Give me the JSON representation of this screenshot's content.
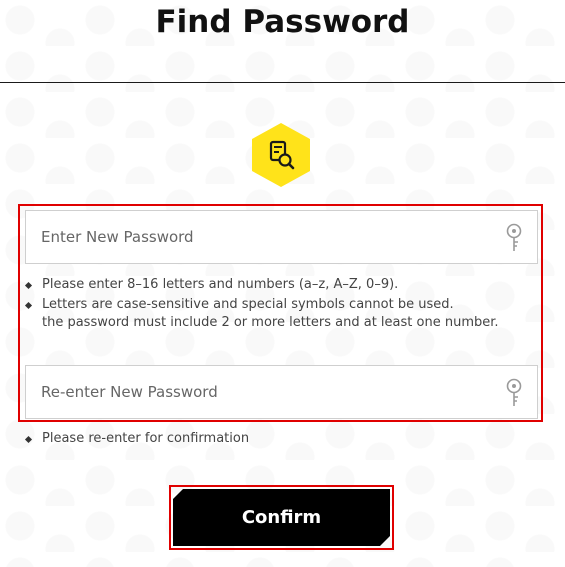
{
  "page": {
    "title": "Find Password"
  },
  "badge": {
    "icon": "search-document-icon",
    "color": "#FFE31A"
  },
  "form": {
    "new_password": {
      "value": "",
      "placeholder": "Enter New Password",
      "icon": "key-icon"
    },
    "requirements": [
      {
        "lines": [
          "Please enter 8–16 letters and numbers (a–z, A–Z, 0–9)."
        ]
      },
      {
        "lines": [
          "Letters are case-sensitive and special symbols cannot be used.",
          "the password must include 2 or more letters and at least one number."
        ]
      }
    ],
    "confirm_password": {
      "value": "",
      "placeholder": "Re-enter New Password",
      "icon": "key-icon"
    },
    "confirm_hint": "Please re-enter for confirmation"
  },
  "actions": {
    "confirm_label": "Confirm"
  },
  "colors": {
    "highlight": "#E00000",
    "button": "#000000",
    "accent": "#FFE31A"
  }
}
